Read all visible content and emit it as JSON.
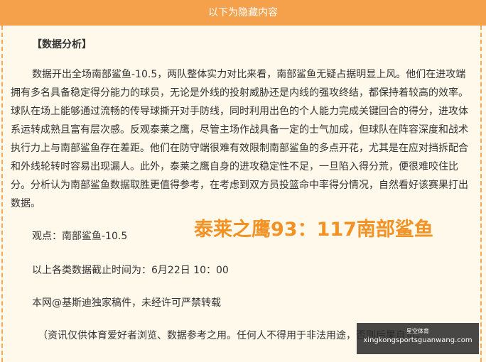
{
  "banner": {
    "text": "以下为隐藏内容"
  },
  "article": {
    "heading": "【数据分析】",
    "paragraph": "数据开出全场南部鲨鱼-10.5，两队整体实力对比来看，南部鲨鱼无疑占据明显上风。他们在进攻端拥有多名具备稳定得分能力的球员，无论是外线的投射威胁还是内线的强攻终结，都保持着较高的效率。球队在场上能够通过流畅的传导球撕开对手防线，同时利用出色的个人能力完成关键回合的得分，进攻体系运转成熟且富有层次感。反观泰莱之鹰，尽管主场作战具备一定的士气加成，但球队在阵容深度和战术执行力上与南部鲨鱼存在差距。他们在防守端很难有效限制南部鲨鱼的多点开花，尤其是在应对挡拆配合和外线轮转时容易出现漏人。此外，泰莱之鹰自身的进攻稳定性不足，一旦陷入得分荒，便很难咬住比分。分析认为南部鲨鱼数据取胜更值得参考，在考虑到双方员投篮命中率得分情况，自然看好该赛果打出数据。",
    "viewpoint": "观点：南部鲨鱼-10.5",
    "score_prediction": "泰莱之鹰93：117南部鲨鱼",
    "cutoff_time": "以上各类数据截止时间为：6月22日 10：00",
    "notice": "本网@基斯迪独家稿件，未经许可严禁转载",
    "disclaimer": "（资讯仅供体育爱好者浏览、数据参考之用。任何人不得用于非法用途，否则后果自负。"
  },
  "watermark": {
    "top": "星空体育",
    "url": "xingkongsportsguanwang.com"
  },
  "colors": {
    "banner": "#f5a04a",
    "accent": "#f39123",
    "background": "#fff9ec"
  }
}
